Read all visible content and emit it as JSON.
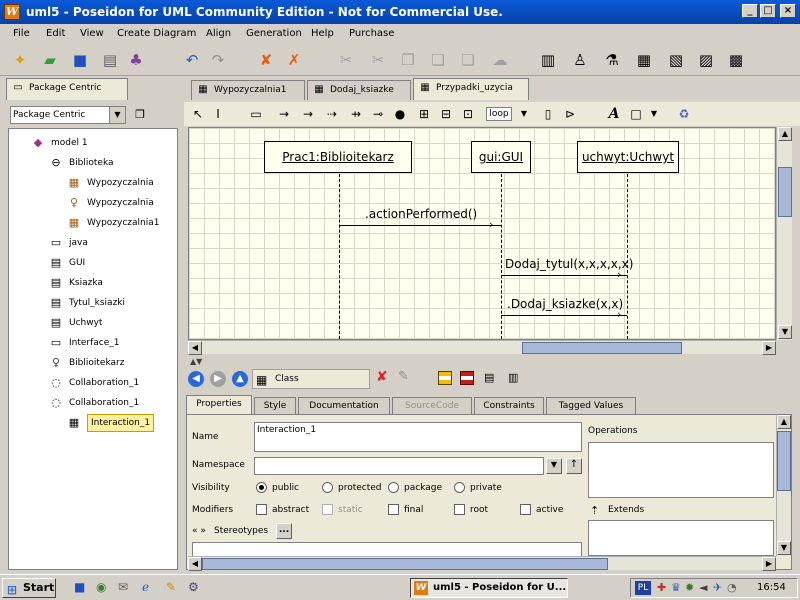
{
  "window": {
    "title": "uml5 - Poseidon for UML Community Edition - Not for Commercial Use.",
    "min": "_",
    "max": "□",
    "close": "×"
  },
  "menu": [
    "File",
    "Edit",
    "View",
    "Create Diagram",
    "Align",
    "Generation",
    "Help",
    "Purchase"
  ],
  "navigator": {
    "tab": "Package Centric",
    "combo_value": "Package Centric",
    "tree": [
      {
        "label": "model 1",
        "icon": "model-icon",
        "level": 0
      },
      {
        "label": "Biblioteka",
        "icon": "package-icon",
        "level": 1
      },
      {
        "label": "Wypozyczalnia",
        "icon": "sequence-diagram-icon",
        "level": 2
      },
      {
        "label": "Wypozyczalnia",
        "icon": "usecase-diagram-icon",
        "level": 2
      },
      {
        "label": "Wypozyczalnia1",
        "icon": "sequence-diagram-icon",
        "level": 2
      },
      {
        "label": "java",
        "icon": "folder-icon",
        "level": 1
      },
      {
        "label": "GUI",
        "icon": "class-icon",
        "level": 1
      },
      {
        "label": "Ksiazka",
        "icon": "class-icon",
        "level": 1
      },
      {
        "label": "Tytul_ksiazki",
        "icon": "class-icon",
        "level": 1
      },
      {
        "label": "Uchwyt",
        "icon": "class-icon",
        "level": 1
      },
      {
        "label": "Interface_1",
        "icon": "interface-icon",
        "level": 1
      },
      {
        "label": "Biblioitekarz",
        "icon": "actor-icon",
        "level": 1
      },
      {
        "label": "Collaboration_1",
        "icon": "collaboration-icon",
        "level": 1
      },
      {
        "label": "Collaboration_1",
        "icon": "collaboration-icon",
        "level": 1
      },
      {
        "label": "Interaction_1",
        "icon": "interaction-icon",
        "level": 2,
        "selected": true
      }
    ]
  },
  "diagram_tabs": [
    "Wypozyczalnia1",
    "Dodaj_ksiazke",
    "Przypadki_uzycia"
  ],
  "diagram": {
    "objects": [
      {
        "label": "Prac1:Biblioitekarz"
      },
      {
        "label": "gui:GUI"
      },
      {
        "label": "uchwyt:Uchwyt"
      }
    ],
    "messages": [
      {
        "label": ".actionPerformed()"
      },
      {
        "label": "Dodaj_tytul(x,x,x,x,x)"
      },
      {
        "label": ".Dodaj_ksiazke(x,x)"
      }
    ],
    "loop_label": "loop"
  },
  "details": {
    "element_type": "Class",
    "tabs": [
      "Properties",
      "Style",
      "Documentation",
      "SourceCode",
      "Constraints",
      "Tagged Values"
    ],
    "active_tab": "Properties",
    "name_label": "Name",
    "name_value": "Interaction_1",
    "namespace_label": "Namespace",
    "namespace_value": "",
    "visibility_label": "Visibility",
    "visibility_options": [
      "public",
      "protected",
      "package",
      "private"
    ],
    "visibility_selected": "public",
    "modifiers_label": "Modifiers",
    "modifiers": [
      "abstract",
      "static",
      "final",
      "root",
      "active"
    ],
    "stereotypes_label": "Stereotypes",
    "stereotypes_prefix": "« »",
    "stereotypes_button": "...",
    "operations_label": "Operations",
    "extends_label": "Extends"
  },
  "taskbar": {
    "start": "Start",
    "task": "uml5 - Poseidon for U...",
    "lang": "PL",
    "clock": "16:54"
  }
}
